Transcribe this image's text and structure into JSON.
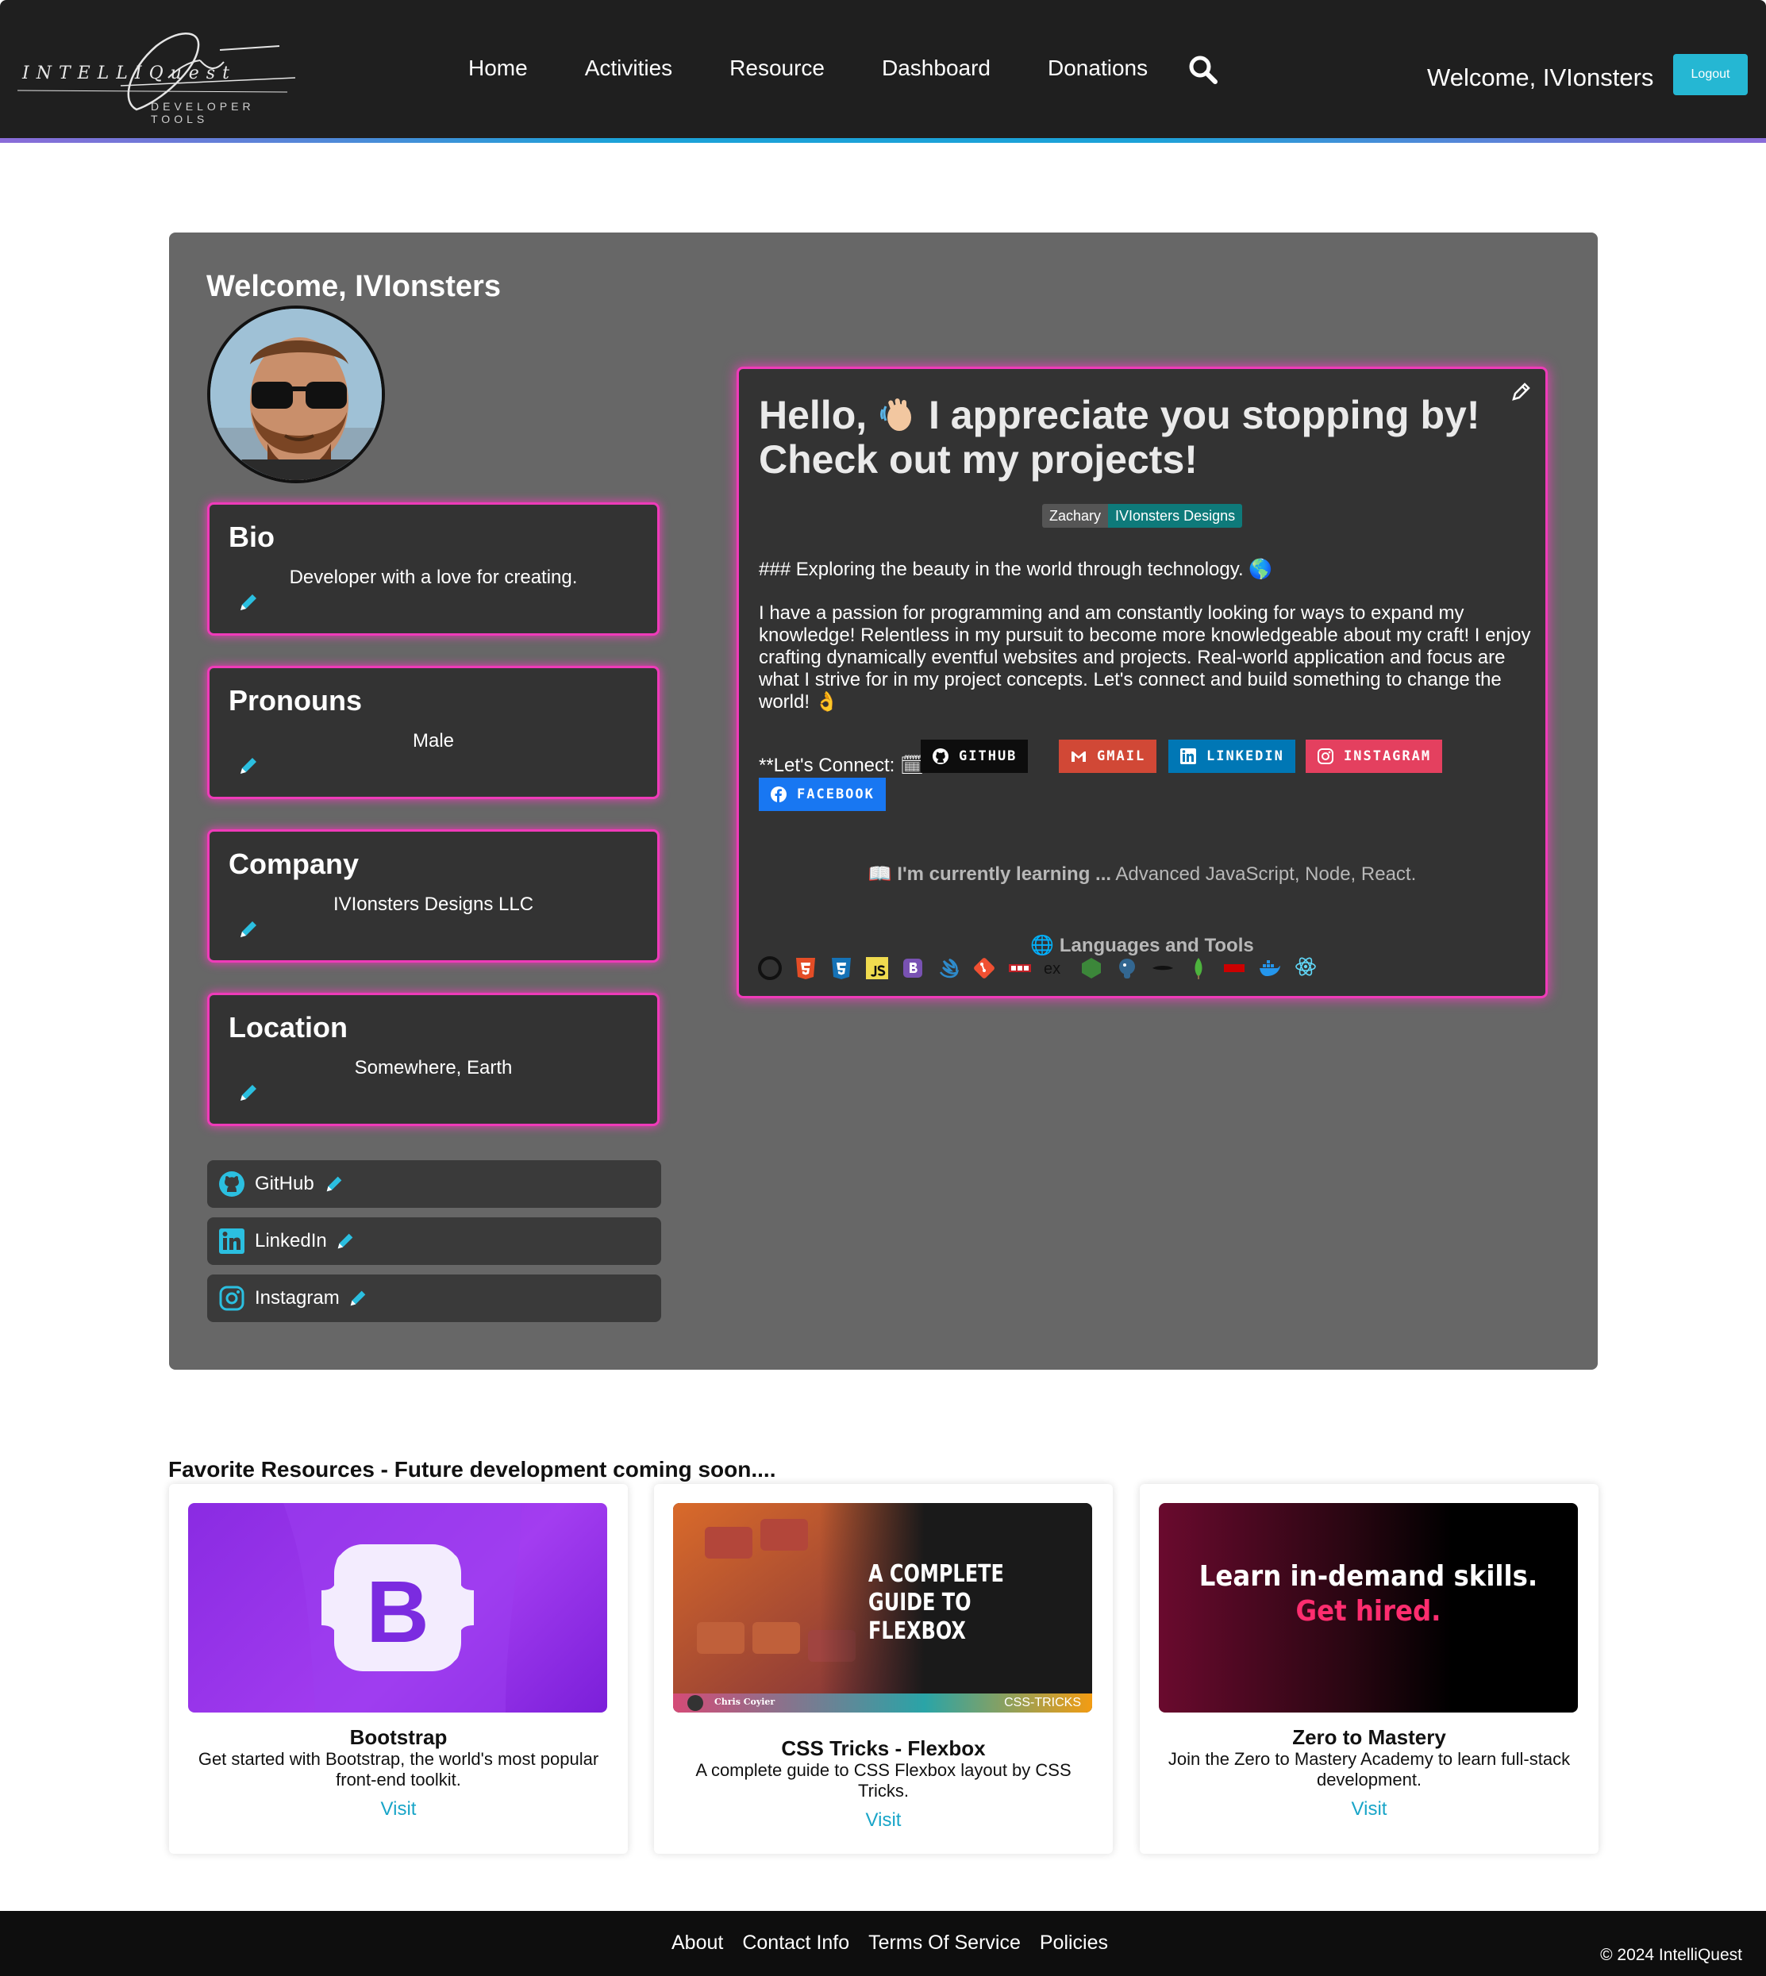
{
  "nav": {
    "logo_main": "INTELLIQuest",
    "logo_sub": "DEVELOPER TOOLS",
    "links": [
      "Home",
      "Activities",
      "Resource",
      "Dashboard",
      "Donations"
    ],
    "welcome": "Welcome, IVIonsters",
    "logout": "Logout"
  },
  "profile": {
    "title": "Welcome, IVIonsters",
    "cards": [
      {
        "title": "Bio",
        "value": "Developer with a love for creating."
      },
      {
        "title": "Pronouns",
        "value": "Male"
      },
      {
        "title": "Company",
        "value": "IVIonsters Designs LLC"
      },
      {
        "title": "Location",
        "value": "Somewhere, Earth"
      }
    ],
    "socials": [
      "GitHub",
      "LinkedIn",
      "Instagram"
    ]
  },
  "readme": {
    "heading_part1": "Hello,",
    "heading_part2": "I appreciate you stopping by! Check out my projects!",
    "badge_left": "Zachary",
    "badge_right": "IVIonsters Designs",
    "subheading": "### Exploring the beauty in the world through technology. 🌎",
    "paragraph": "I have a passion for programming and am constantly looking for ways to expand my knowledge! Relentless in my pursuit to become more knowledgeable about my craft! I enjoy crafting dynamically eventful websites and projects. Real-world application and focus are what I strive for in my project concepts. Let's connect and build something to change the world! 👌",
    "connect": "**Let's Connect: 🗓 **",
    "buttons": [
      "GITHUB",
      "GMAIL",
      "LINKEDIN",
      "INSTAGRAM",
      "FACEBOOK"
    ],
    "learning_label": "📖 I'm currently learning ...",
    "learning_value": "Advanced JavaScript, Node, React.",
    "langs_title": "🌐 Languages and Tools"
  },
  "resources": {
    "title": "Favorite Resources - Future development coming soon....",
    "items": [
      {
        "name": "Bootstrap",
        "desc": "Get started with Bootstrap, the world's most popular front-end toolkit.",
        "link": "Visit"
      },
      {
        "name": "CSS Tricks - Flexbox",
        "desc": "A complete guide to CSS Flexbox layout by CSS Tricks.",
        "link": "Visit",
        "img_title": "A COMPLETE GUIDE TO FLEXBOX",
        "img_author": "Chris Coyier",
        "img_brand": "CSS-TRICKS"
      },
      {
        "name": "Zero to Mastery",
        "desc": "Join the Zero to Mastery Academy to learn full-stack development.",
        "link": "Visit",
        "img_line1": "Learn in-demand skills.",
        "img_line2": "Get hired."
      }
    ]
  },
  "footer": {
    "links": [
      "About",
      "Contact Info",
      "Terms Of Service",
      "Policies"
    ],
    "copyright": "© 2024 IntelliQuest"
  },
  "colors": {
    "accent": "#25b7d3",
    "glow": "#ef3bb9",
    "nav_bg": "#1f1f1f",
    "panel_bg": "#676767"
  }
}
